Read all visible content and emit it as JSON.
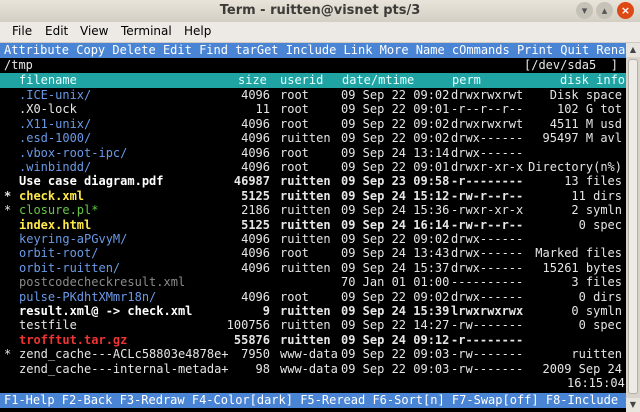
{
  "window": {
    "title": "Term - ruitten@visnet pts/3"
  },
  "menubar": {
    "items": [
      "File",
      "Edit",
      "View",
      "Terminal",
      "Help"
    ]
  },
  "commandbar": "Attribute Copy Delete Edit Find tarGet Include Link More Name cOmmands Print Quit Rename >",
  "path": {
    "left": "/tmp",
    "right": "[/dev/sda5  ]"
  },
  "headers": {
    "filename": "filename",
    "size": "size",
    "userid": "userid",
    "date": "date/mtime",
    "perm": "perm",
    "info": "disk info"
  },
  "colors": {
    "header_bg": "#1fa3a3",
    "cmdbar_bg": "#4a84d4",
    "dir": "#6a9ae6",
    "exec": "#66c844",
    "bold_yellow": "#ffe84a",
    "text": "#e6e6e6",
    "dim": "#8a8a8a",
    "red": "#ee3333"
  },
  "files": [
    {
      "mark": "",
      "name": ".ICE-unix/",
      "size": "4096",
      "user": "root",
      "date": "09 Sep 22 09:02",
      "perm": "drwxrwxrwt",
      "info": "Disk space",
      "type": "dir"
    },
    {
      "mark": "",
      "name": ".X0-lock",
      "size": "11",
      "user": "root",
      "date": "09 Sep 22 09:01",
      "perm": "-r--r--r--",
      "info": "102 G tot",
      "type": "file"
    },
    {
      "mark": "",
      "name": ".X11-unix/",
      "size": "4096",
      "user": "root",
      "date": "09 Sep 22 09:02",
      "perm": "drwxrwxrwt",
      "info": "4511 M usd",
      "type": "dir"
    },
    {
      "mark": "",
      "name": ".esd-1000/",
      "size": "4096",
      "user": "ruitten",
      "date": "09 Sep 22 09:02",
      "perm": "drwx------",
      "info": "95497 M avl",
      "type": "dir"
    },
    {
      "mark": "",
      "name": ".vbox-root-ipc/",
      "size": "4096",
      "user": "root",
      "date": "09 Sep 24 13:14",
      "perm": "drwx------",
      "info": "",
      "type": "dir"
    },
    {
      "mark": "",
      "name": ".winbindd/",
      "size": "4096",
      "user": "root",
      "date": "09 Sep 22 09:01",
      "perm": "drwxr-xr-x",
      "info": "Directory(n%)",
      "type": "dir"
    },
    {
      "mark": "",
      "name": "Use case diagram.pdf",
      "size": "46987",
      "user": "ruitten",
      "date": "09 Sep 23 09:58",
      "perm": "-r--------",
      "info": "13 files",
      "type": "current"
    },
    {
      "mark": "*",
      "name": "check.xml",
      "size": "5125",
      "user": "ruitten",
      "date": "09 Sep 24 15:12",
      "perm": "-rw-r--r--",
      "info": "11 dirs",
      "type": "tagged"
    },
    {
      "mark": "*",
      "name": "closure.pl*",
      "size": "2186",
      "user": "ruitten",
      "date": "09 Sep 24 15:36",
      "perm": "-rwxr-xr-x",
      "info": "2 symln",
      "type": "exec"
    },
    {
      "mark": "",
      "name": "index.html",
      "size": "5125",
      "user": "ruitten",
      "date": "09 Sep 24 16:14",
      "perm": "-rw-r--r--",
      "info": "0 spec",
      "type": "tagged"
    },
    {
      "mark": "",
      "name": "keyring-aPGvyM/",
      "size": "4096",
      "user": "ruitten",
      "date": "09 Sep 22 09:02",
      "perm": "drwx------",
      "info": "",
      "type": "dir"
    },
    {
      "mark": "",
      "name": "orbit-root/",
      "size": "4096",
      "user": "root",
      "date": "09 Sep 24 13:43",
      "perm": "drwx------",
      "info": "Marked files",
      "type": "dir"
    },
    {
      "mark": "",
      "name": "orbit-ruitten/",
      "size": "4096",
      "user": "ruitten",
      "date": "09 Sep 24 15:37",
      "perm": "drwx------",
      "info": "15261 bytes",
      "type": "dir"
    },
    {
      "mark": "",
      "name": "postcodecheckresult.xml",
      "size": "",
      "user": "",
      "date": "70 Jan 01 01:00",
      "perm": "----------",
      "info": "3 files",
      "type": "dim"
    },
    {
      "mark": "",
      "name": "pulse-PKdhtXMmr18n/",
      "size": "4096",
      "user": "root",
      "date": "09 Sep 22 09:02",
      "perm": "drwx------",
      "info": "0 dirs",
      "type": "dir"
    },
    {
      "mark": "",
      "name": "result.xml@ -> check.xml",
      "size": "9",
      "user": "ruitten",
      "date": "09 Sep 24 15:39",
      "perm": "lrwxrwxrwx",
      "info": "0 symln",
      "type": "link"
    },
    {
      "mark": "",
      "name": "testfile",
      "size": "100756",
      "user": "ruitten",
      "date": "09 Sep 22 14:27",
      "perm": "-rw-------",
      "info": "0 spec",
      "type": "file"
    },
    {
      "mark": "",
      "name": "trofftut.tar.gz",
      "size": "55876",
      "user": "ruitten",
      "date": "09 Sep 24 09:12",
      "perm": "-r--------",
      "info": "",
      "type": "archive"
    },
    {
      "mark": "*",
      "name": "zend_cache---ACLc58803e4878e+",
      "size": "7950",
      "user": "www-data",
      "date": "09 Sep 22 09:03",
      "perm": "-rw-------",
      "info": "ruitten",
      "type": "file"
    },
    {
      "mark": "",
      "name": "zend_cache---internal-metada+",
      "size": "98",
      "user": "www-data",
      "date": "09 Sep 22 09:03",
      "perm": "-rw-------",
      "info": "2009 Sep 24",
      "type": "file"
    }
  ],
  "clock": "16:15:04",
  "fkeys": "F1-Help F2-Back F3-Redraw F4-Color[dark] F5-Reread F6-Sort[n] F7-Swap[off] F8-Include >"
}
